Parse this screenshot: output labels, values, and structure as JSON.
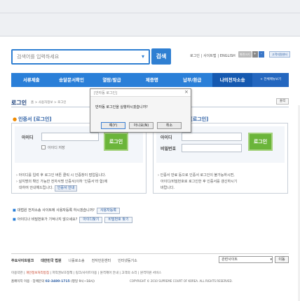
{
  "search": {
    "placeholder": "검색어를 입력하세요",
    "button": "검색"
  },
  "utility": {
    "links": [
      "로그인",
      "사이트맵",
      "ENGLISH"
    ],
    "font_label": "화면크기",
    "font_plus": "+",
    "font_minus": "-",
    "login_setting": "고객지원센터"
  },
  "nav": {
    "items": [
      "서류제출",
      "송달문서확인",
      "열람/발급",
      "제증명",
      "납부/환급",
      "나의전자소송"
    ],
    "all_menu": "+ 전체메뉴보기"
  },
  "header": {
    "title": "로그인",
    "breadcrumb": "홈 > 사용자정보 > 로그인",
    "print": "출력"
  },
  "left_panel": {
    "heading": "인증서 [로그인]",
    "id_label": "아이디",
    "save_label": "아이디 저장",
    "login_button": "로그인",
    "note1": "아이디를 입력 후 로그인 버튼 클릭 시 인증창이 팝업됩니다.",
    "note2a": "실지명의 확인 가능한 전자서명 인증서(이하 '인증서'라 함)에",
    "note2b": "대하여 안내해드립니다.",
    "cert_guide": "인증서 안내"
  },
  "right_panel": {
    "heading": "인증서 미사용 [로그인]",
    "id_label": "아이디",
    "pw_label": "비밀번호",
    "login_button": "로그인",
    "note1": "인증서 만료 등으로 인증서 로그인이 불가능하시면,",
    "note2": "아이디/비밀번호로 로그인한 후 인증서를 갱신하시기",
    "note3": "바랍니다."
  },
  "links": {
    "signup_q": "대법원 전자소송 사이트에 사용자등록 하시겠습니까?",
    "signup_btn": "사용자등록",
    "find_q": "아이디나 비밀번호가 기억나지 않으세요?",
    "find_id": "아이디찾기",
    "find_pw": "비밀번호 찾기"
  },
  "footer": {
    "links": [
      "주요사이트링크",
      "대한민국 법원",
      "나홀로소송",
      "전자민원센터",
      "인터넷등기소"
    ],
    "related": "관련사이트",
    "go": "이동",
    "sub_prefix": "이용약관 | ",
    "privacy": "개인정보처리방침",
    "sub_rest": " | 저작권보호정책 | 링크/사이트이용 | 원격제어 안내 | 고객의 소리 | 원격지원 서비스",
    "phone_prefix": "홈페이지 이용 · 장애문의 ",
    "phone": "02-3480-1715",
    "phone_hours": " (평일 9시~18시)",
    "copyright": "COPYRIGHT © 2010 SUPREME COURT OF KOREA. ALL RIGHTS RESERVED."
  },
  "dialog": {
    "title": "[반자동 로그인]",
    "close": "×",
    "message": "반자동 로그인을 실행하시겠습니까?",
    "yes": "예(Y)",
    "no": "아니요(N)",
    "cancel": "취소"
  }
}
